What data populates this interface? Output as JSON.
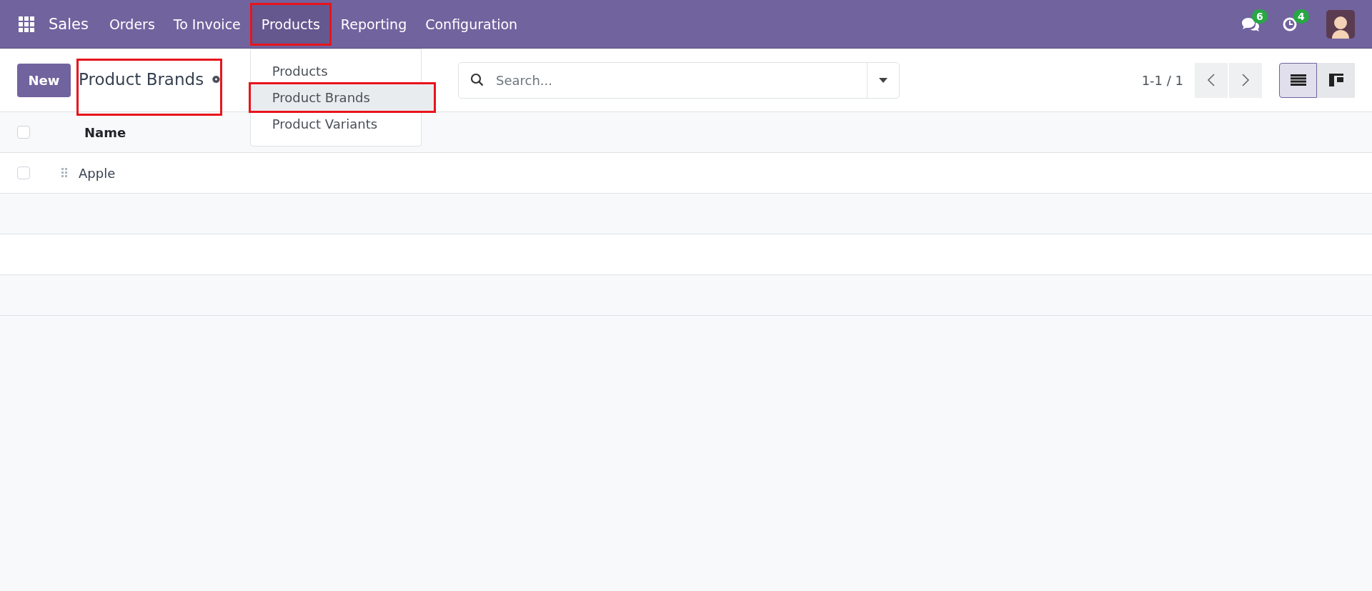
{
  "navbar": {
    "app_name": "Sales",
    "menu": [
      {
        "label": "Orders",
        "selected": false,
        "highlighted": false
      },
      {
        "label": "To Invoice",
        "selected": false,
        "highlighted": false
      },
      {
        "label": "Products",
        "selected": true,
        "highlighted": true
      },
      {
        "label": "Reporting",
        "selected": false,
        "highlighted": false
      },
      {
        "label": "Configuration",
        "selected": false,
        "highlighted": false
      }
    ],
    "messages_badge": "6",
    "activities_badge": "4"
  },
  "dropdown": {
    "items": [
      {
        "label": "Products",
        "selected": false,
        "highlighted": false
      },
      {
        "label": "Product Brands",
        "selected": true,
        "highlighted": true
      },
      {
        "label": "Product Variants",
        "selected": false,
        "highlighted": false
      }
    ]
  },
  "control_panel": {
    "new_button": "New",
    "title": "Product Brands",
    "title_highlighted": true,
    "search": {
      "placeholder": "Search..."
    },
    "pager": "1-1 / 1",
    "views": [
      {
        "kind": "list",
        "selected": true
      },
      {
        "kind": "kanban",
        "selected": false
      }
    ]
  },
  "table": {
    "select_all_checked": false,
    "columns": [
      "Name"
    ],
    "rows": [
      {
        "name": "Apple",
        "checked": false
      }
    ]
  }
}
